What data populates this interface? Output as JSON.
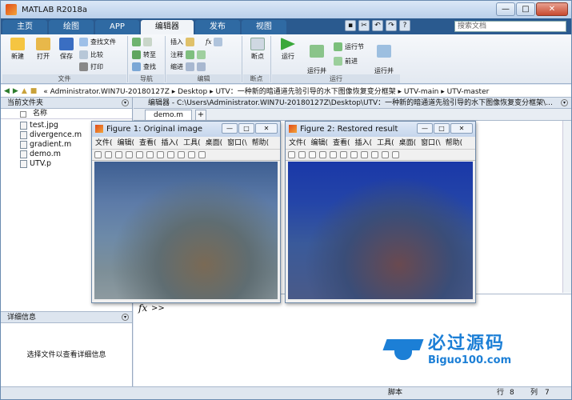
{
  "app": {
    "title": "MATLAB R2018a"
  },
  "window_controls": {
    "min": "—",
    "max": "□",
    "close": "✕"
  },
  "tabs": [
    "主页",
    "绘图",
    "APP",
    "编辑器",
    "发布",
    "视图"
  ],
  "search": {
    "placeholder": "搜索文档"
  },
  "ribbon": {
    "file": {
      "new": "新建",
      "open": "打开",
      "save": "保存",
      "find_files": "查找文件",
      "compare": "比较",
      "print": "打印",
      "group": "文件"
    },
    "nav": {
      "goto": "转至",
      "find": "查找",
      "group": "导航"
    },
    "edit": {
      "insert": "插入",
      "comment": "注释",
      "indent": "缩进",
      "fx": "fx",
      "group": "编辑"
    },
    "breakpoints": {
      "label": "断点",
      "group": "断点"
    },
    "run": {
      "run": "运行",
      "run_advance": "运行并\n前进",
      "run_section": "运行节",
      "advance": "前进",
      "run_time": "运行并\n计时",
      "group": "运行"
    }
  },
  "address": {
    "path": "« Administrator.WIN7U-20180127Z  ▸  Desktop  ▸  UTV：一种新的暗通道先验引导的水下图像恢复变分框架  ▸  UTV-main  ▸  UTV-master"
  },
  "left_pane": {
    "title": "当前文件夹",
    "col_name": "名称",
    "files": [
      "test.jpg",
      "divergence.m",
      "gradient.m",
      "demo.m",
      "UTV.p"
    ],
    "details_title": "详细信息",
    "details_msg": "选择文件以查看详细信息"
  },
  "editor": {
    "title": "编辑器 - C:\\Users\\Administrator.WIN7U-20180127Z\\Desktop\\UTV：一种新的暗通道先验引导的水下图像恢复变分框架\\...",
    "tab": "demo.m",
    "plus": "+"
  },
  "command": {
    "prompt": ">>",
    "fx": "fx"
  },
  "figure1": {
    "title": "Figure 1: Original image",
    "menu": [
      "文件(",
      "编辑(",
      "查看(",
      "插入(",
      "工具(",
      "桌面(",
      "窗口(\\",
      "帮助("
    ]
  },
  "figure2": {
    "title": "Figure 2: Restored result",
    "menu": [
      "文件(",
      "编辑(",
      "查看(",
      "插入(",
      "工具(",
      "桌面(",
      "窗口(\\",
      "帮助("
    ]
  },
  "status": {
    "script": "脚本",
    "row_label": "行",
    "row": "8",
    "col_label": "列",
    "col": "7"
  },
  "watermark": {
    "cn": "必过源码",
    "en": "Biguo100.com"
  }
}
